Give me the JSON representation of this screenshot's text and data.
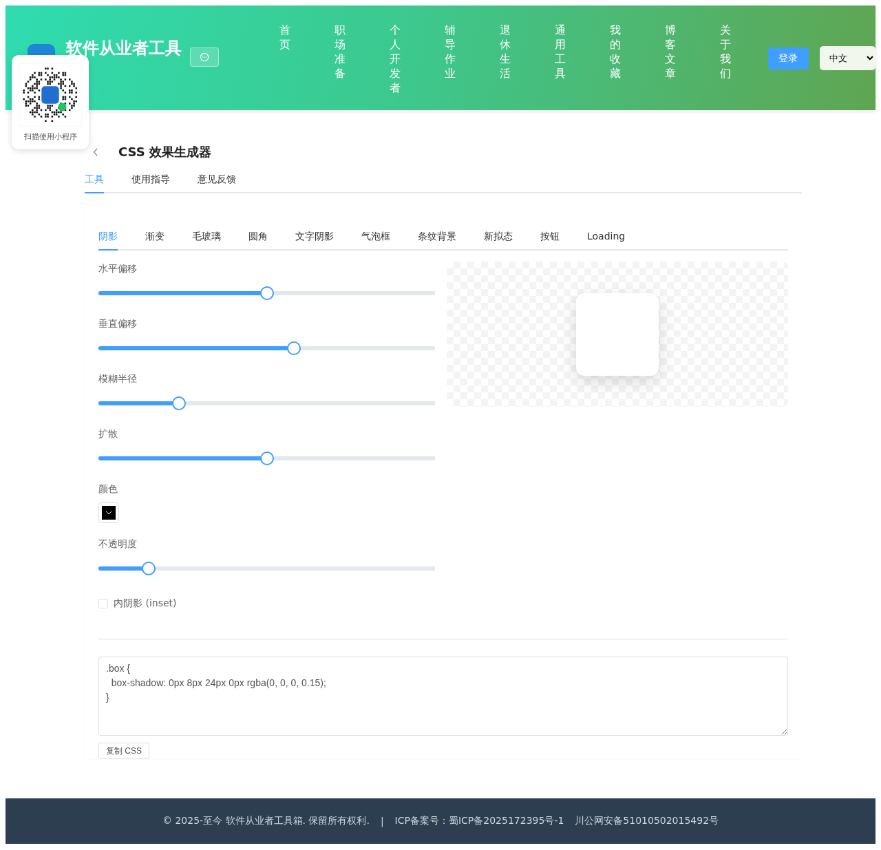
{
  "header": {
    "site_title": "软件从业者工具",
    "nav": [
      {
        "label": "首页"
      },
      {
        "label": "职场准备"
      },
      {
        "label": "个人开发者"
      },
      {
        "label": "辅导作业"
      },
      {
        "label": "退休生活"
      },
      {
        "label": "通用工具"
      },
      {
        "label": "我的收藏"
      },
      {
        "label": "博客文章"
      },
      {
        "label": "关于我们"
      }
    ],
    "login": "登录",
    "language": "中文"
  },
  "qr_popup": {
    "caption": "扫描使用小程序"
  },
  "page_title": "CSS 效果生成器",
  "tabs": [
    {
      "label": "工具",
      "selected": true
    },
    {
      "label": "使用指导",
      "selected": false
    },
    {
      "label": "意见反馈",
      "selected": false
    }
  ],
  "effect_tabs": [
    {
      "label": "阴影",
      "selected": true
    },
    {
      "label": "渐变",
      "selected": false
    },
    {
      "label": "毛玻璃",
      "selected": false
    },
    {
      "label": "圆角",
      "selected": false
    },
    {
      "label": "文字阴影",
      "selected": false
    },
    {
      "label": "气泡框",
      "selected": false
    },
    {
      "label": "条纹背景",
      "selected": false
    },
    {
      "label": "新拟态",
      "selected": false
    },
    {
      "label": "按钮",
      "selected": false
    },
    {
      "label": "Loading",
      "selected": false
    }
  ],
  "controls": [
    {
      "kind": "slider",
      "label": "水平偏移",
      "level": 0.5
    },
    {
      "kind": "slider",
      "label": "垂直偏移",
      "level": 0.58
    },
    {
      "kind": "slider",
      "label": "模糊半径",
      "level": 0.24
    },
    {
      "kind": "slider",
      "label": "扩散",
      "level": 0.5
    },
    {
      "kind": "color",
      "label": "颜色",
      "color": "#000000"
    },
    {
      "kind": "slider",
      "label": "不透明度",
      "level": 0.15
    },
    {
      "kind": "checkbox",
      "label": "内阴影 (inset)",
      "checked": false
    }
  ],
  "css_output": ".box {\n  box-shadow: 0px 8px 24px 0px rgba(0, 0, 0, 0.15);\n}",
  "copy_button": "复制 CSS",
  "footer": {
    "copyright": "© 2025-至今 软件从业者工具箱. 保留所有权利.",
    "separator": "|",
    "icp": "ICP备案号：蜀ICP备2025172395号-1",
    "police": "川公网安备51010502015492号"
  }
}
